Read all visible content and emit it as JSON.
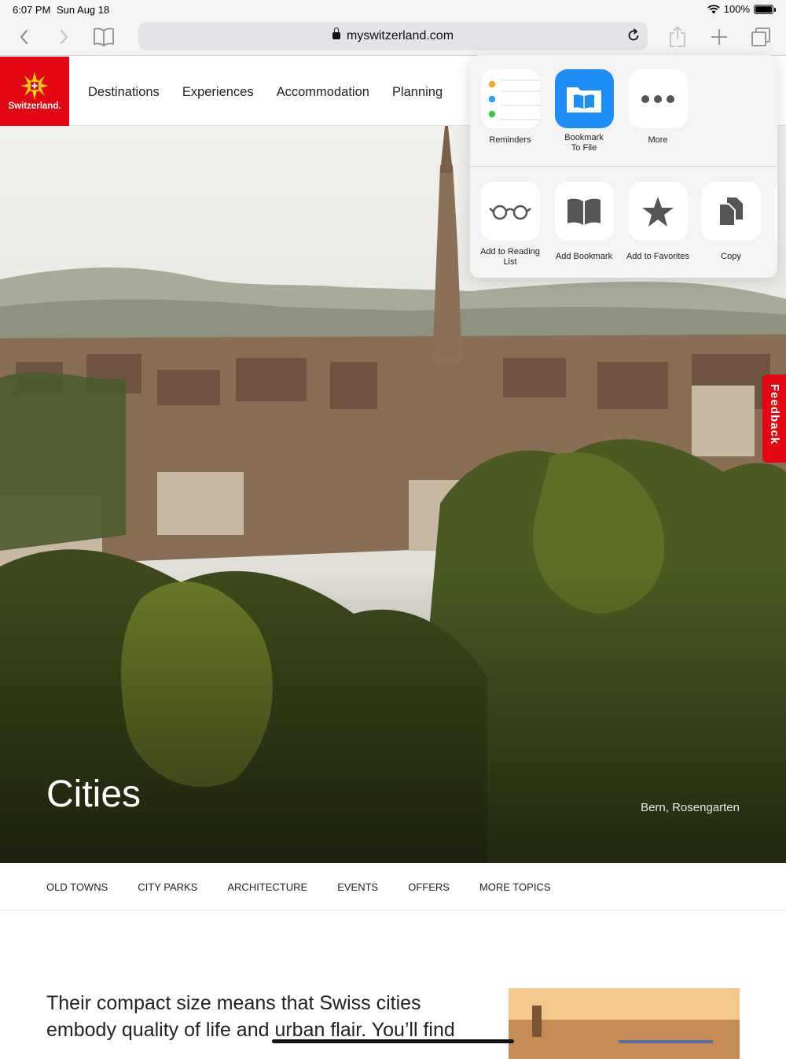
{
  "status_bar": {
    "time": "6:07 PM",
    "date": "Sun Aug 18",
    "battery": "100%"
  },
  "browser": {
    "url": "myswitzerland.com",
    "icons": [
      "back-icon",
      "forward-icon",
      "bookmarks-icon",
      "lock-icon",
      "reload-icon",
      "share-icon",
      "new-tab-icon",
      "tabs-icon"
    ]
  },
  "site": {
    "logo_text": "Switzerland.",
    "nav": [
      "Destinations",
      "Experiences",
      "Accommodation",
      "Planning"
    ]
  },
  "hero": {
    "title": "Cities",
    "caption": "Bern, Rosengarten",
    "feedback": "Feedback"
  },
  "topics": [
    "OLD TOWNS",
    "CITY PARKS",
    "ARCHITECTURE",
    "EVENTS",
    "OFFERS",
    "MORE TOPICS"
  ],
  "intro": {
    "line1": "Their compact size means that Swiss cities",
    "line2": "embody quality of life and urban flair. You’ll find"
  },
  "share_sheet": {
    "apps": [
      {
        "label": "Reminders",
        "icon": "reminders-icon"
      },
      {
        "label": "Bookmark\nTo File",
        "icon": "bookmark-to-file-icon"
      },
      {
        "label": "More",
        "icon": "more-icon"
      }
    ],
    "actions": [
      {
        "label": "Add to Reading\nList",
        "icon": "glasses-icon"
      },
      {
        "label": "Add Bookmark",
        "icon": "book-icon"
      },
      {
        "label": "Add to Favorites",
        "icon": "star-icon"
      },
      {
        "label": "Copy",
        "icon": "copy-icon"
      }
    ]
  },
  "colors": {
    "brand_red": "#e30613",
    "ios_blue": "#1c8ef5"
  }
}
